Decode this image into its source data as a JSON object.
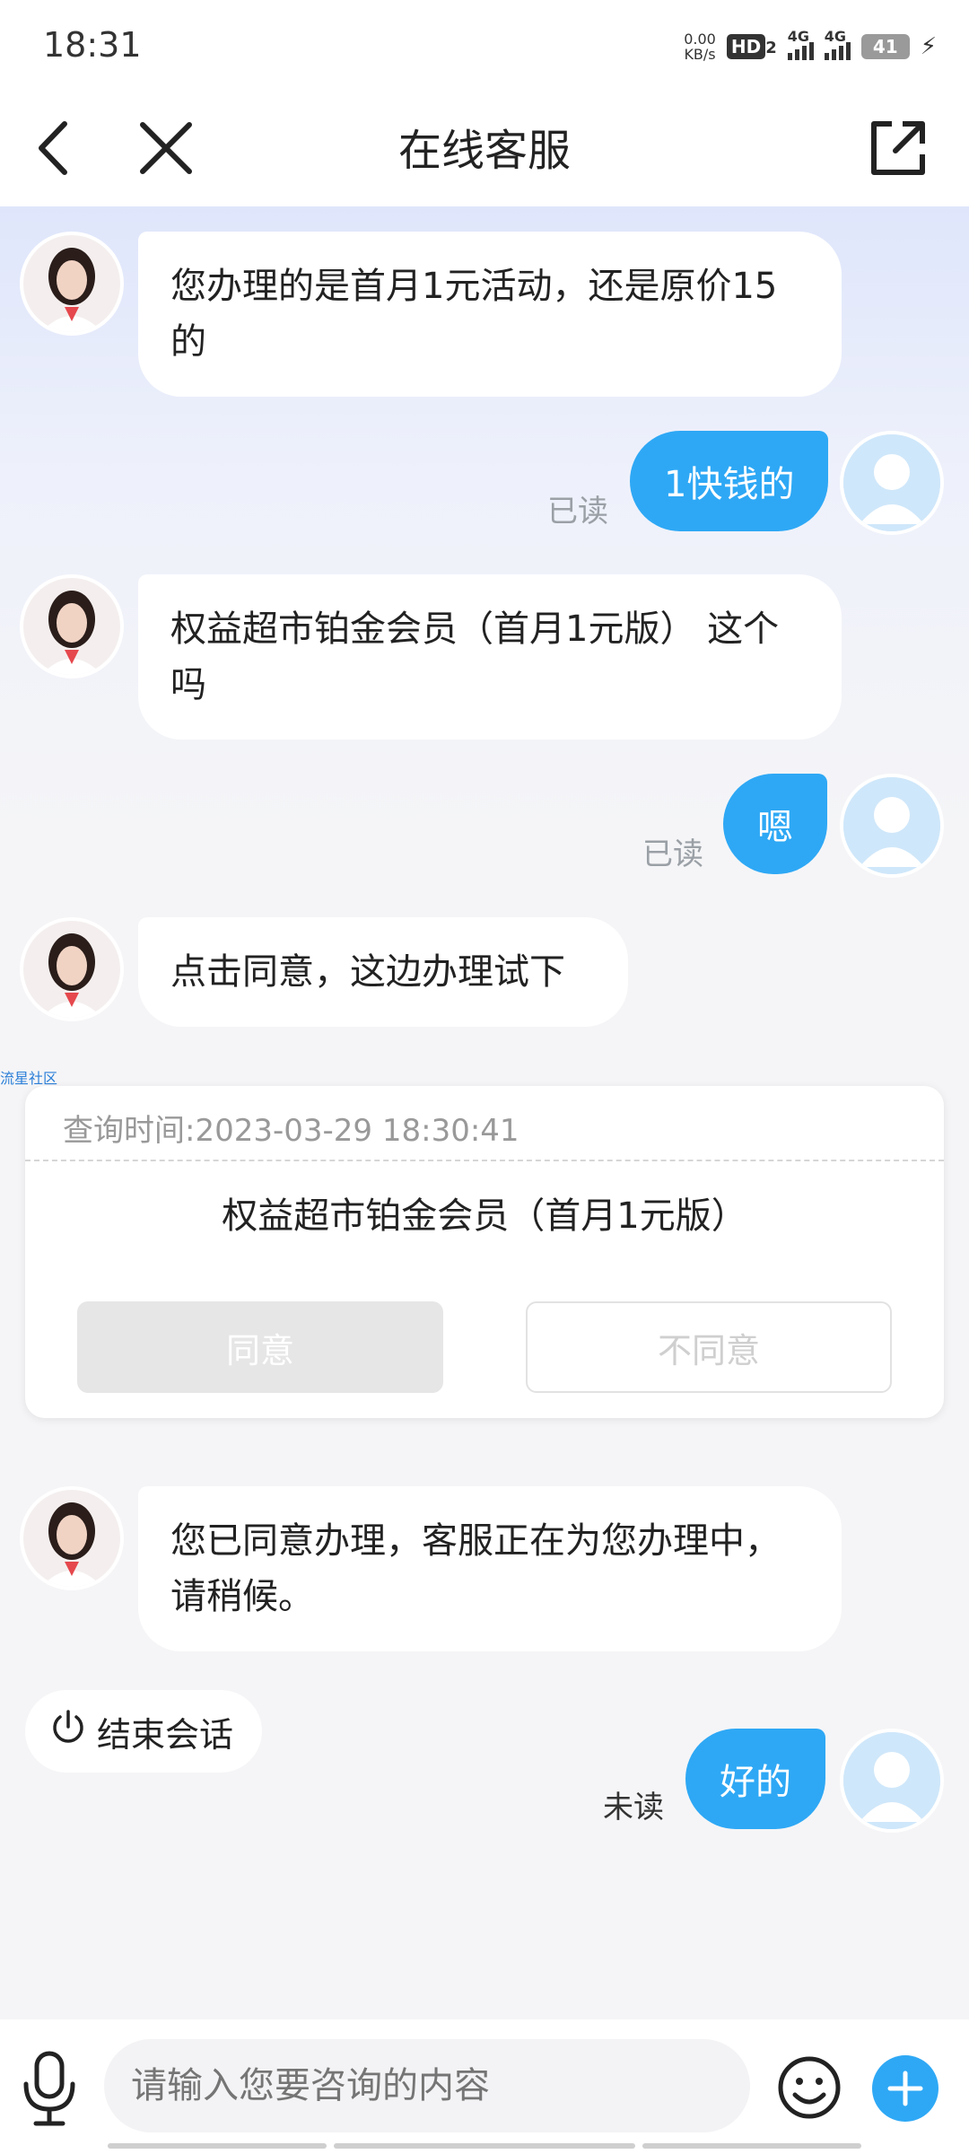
{
  "status_bar": {
    "time": "18:31",
    "net_speed_value": "0.00",
    "net_speed_unit": "KB/s",
    "hd_label": "HD",
    "hd_sub": "2",
    "sim1_label": "4G",
    "sim2_label": "4G",
    "battery": "41"
  },
  "header": {
    "title": "在线客服",
    "icons": [
      "back-icon",
      "close-icon",
      "share-icon"
    ]
  },
  "messages": [
    {
      "side": "agent",
      "text": "您办理的是首月1元活动，还是原价15的"
    },
    {
      "side": "user",
      "text": "1快钱的",
      "status": "已读"
    },
    {
      "side": "agent",
      "text": "权益超市铂金会员（首月1元版） 这个吗"
    },
    {
      "side": "user",
      "text": "嗯",
      "status": "已读"
    },
    {
      "side": "agent",
      "text": "点击同意，这边办理试下"
    },
    {
      "side": "agent",
      "text": "您已同意办理，客服正在为您办理中，请稍候。"
    },
    {
      "side": "user",
      "text": "好的",
      "status": "未读"
    }
  ],
  "watermark": "流星社区",
  "card": {
    "query_time": "查询时间:2023-03-29 18:30:41",
    "product": "权益超市铂金会员（首月1元版）",
    "agree": "同意",
    "disagree": "不同意"
  },
  "end_session": "结束会话",
  "input": {
    "placeholder": "请输入您要咨询的内容"
  },
  "colors": {
    "accent": "#2ea8f5",
    "background": "#f5f5f7"
  }
}
